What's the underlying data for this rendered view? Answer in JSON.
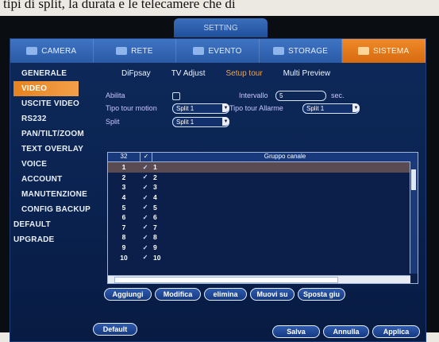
{
  "caption": "tipi di split, la durata e le telecamere che di",
  "window_title": "SETTING",
  "top_tabs": [
    {
      "label": "CAMERA",
      "icon": "camera-icon",
      "active": false
    },
    {
      "label": "RETE",
      "icon": "network-icon",
      "active": false
    },
    {
      "label": "EVENTO",
      "icon": "event-icon",
      "active": false
    },
    {
      "label": "STORAGE",
      "icon": "storage-icon",
      "active": false
    },
    {
      "label": "SISTEMA",
      "icon": "system-icon",
      "active": true
    }
  ],
  "sidebar": [
    {
      "label": "GENERALE",
      "active": false
    },
    {
      "label": "VIDEO",
      "active": true
    },
    {
      "label": "USCITE VIDEO",
      "active": false
    },
    {
      "label": "RS232",
      "active": false
    },
    {
      "label": "PAN/TILT/ZOOM",
      "active": false
    },
    {
      "label": "TEXT OVERLAY",
      "active": false
    },
    {
      "label": "VOICE",
      "active": false
    },
    {
      "label": "ACCOUNT",
      "active": false
    },
    {
      "label": "MANUTENZIONE",
      "active": false
    },
    {
      "label": "CONFIG BACKUP",
      "active": false
    },
    {
      "label": "DEFAULT",
      "active": false
    },
    {
      "label": "UPGRADE",
      "active": false
    }
  ],
  "sub_tabs": [
    {
      "label": "DiFpsay",
      "active": false
    },
    {
      "label": "TV Adjust",
      "active": false
    },
    {
      "label": "Setup tour",
      "active": true
    },
    {
      "label": "Multi Preview",
      "active": false
    }
  ],
  "form": {
    "abilita_label": "Abilita",
    "intervallo_label": "Intervallo",
    "intervallo_value": "5",
    "sec_label": "sec.",
    "tipo_tour_motion_label": "Tipo tour motion",
    "tipo_tour_motion_value": "Split 1",
    "tipo_tour_allarme_label": "Tipo tour Allarme",
    "tipo_tour_allarme_value": "Split 1",
    "split_label": "Split",
    "split_value": "Split 1"
  },
  "table": {
    "header_count": "32",
    "header_check": "✓",
    "header_group": "Gruppo canale",
    "rows": [
      {
        "num": "1",
        "group": "1"
      },
      {
        "num": "2",
        "group": "2"
      },
      {
        "num": "3",
        "group": "3"
      },
      {
        "num": "4",
        "group": "4"
      },
      {
        "num": "5",
        "group": "5"
      },
      {
        "num": "6",
        "group": "6"
      },
      {
        "num": "7",
        "group": "7"
      },
      {
        "num": "8",
        "group": "8"
      },
      {
        "num": "9",
        "group": "9"
      },
      {
        "num": "10",
        "group": "10"
      }
    ]
  },
  "actions": {
    "aggiungi": "Aggiungi",
    "modifica": "Modifica",
    "elimina": "elimina",
    "muovi_su": "Muovi su",
    "sposta_giu": "Sposta giu"
  },
  "footer": {
    "default": "Default",
    "salva": "Salva",
    "annulla": "Annulla",
    "applica": "Applica"
  },
  "colors": {
    "active_tab": "#e27c1a",
    "panel_bg": "#0b2453",
    "nav_bg": "#2f63b2"
  }
}
